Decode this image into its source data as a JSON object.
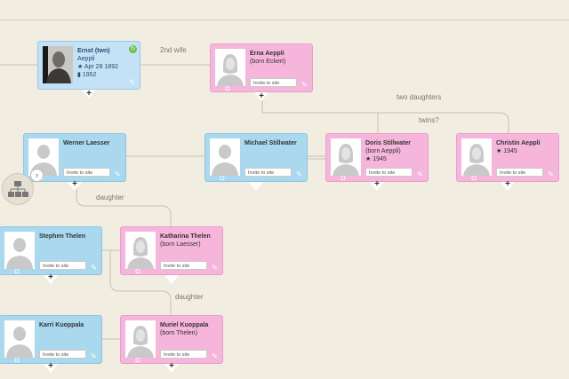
{
  "labels": {
    "second_wife": "2nd wife",
    "two_daughters": "two daughters",
    "twins": "twins?",
    "daughter1": "daughter",
    "daughter2": "daughter"
  },
  "people": {
    "ernst": {
      "name": "Ernst (twn)",
      "line2": "Aeppli",
      "birth": "Apr 28 1892",
      "death": "1952"
    },
    "erna": {
      "name": "Erna Aeppli",
      "line2": "(born Eckert)",
      "invite": "Invite to site"
    },
    "werner": {
      "name": "Werner Laesser",
      "invite": "Invite to site"
    },
    "michael": {
      "name": "Michael Stillwater",
      "invite": "Invite to site"
    },
    "doris": {
      "name": "Doris Stillwater",
      "line2": "(born Aeppli)",
      "birth": "1945",
      "invite": "Invite to site"
    },
    "christin": {
      "name": "Christin Aeppli",
      "birth": "1945",
      "invite": "Invite to site"
    },
    "stephen": {
      "name": "Stephen Thelen",
      "invite": "Invite to site"
    },
    "katharina": {
      "name": "Katharina Thelen",
      "line2": "(born Laesser)",
      "invite": "Invite to site"
    },
    "karri": {
      "name": "Karri Kuoppala",
      "invite": "Invite to site"
    },
    "muriel": {
      "name": "Muriel Kuoppala",
      "line2": "(born Thelen)",
      "invite": "Invite to site"
    }
  },
  "symbols": {
    "plus": "+",
    "star": "★",
    "death": "▮",
    "edit": "✎",
    "camera": "◘",
    "refresh": "↻",
    "arrow": "›"
  }
}
